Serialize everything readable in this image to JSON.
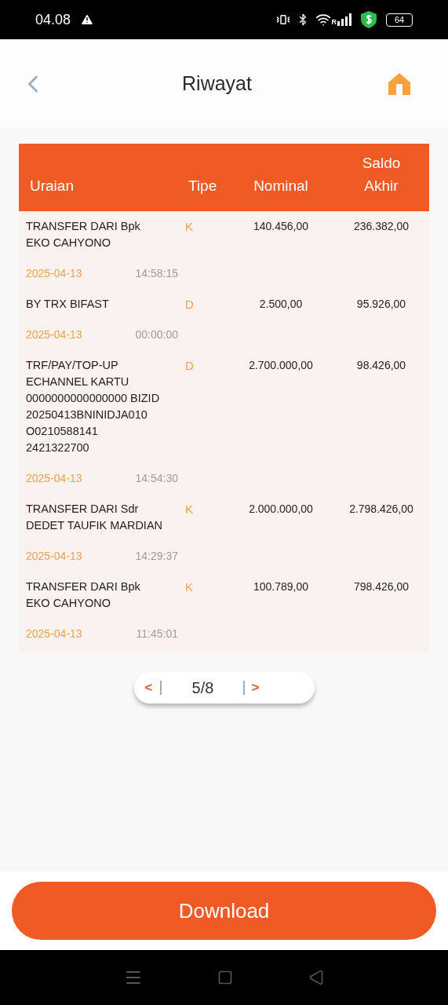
{
  "status_bar": {
    "time": "04.08",
    "network_label": "R",
    "battery": "64"
  },
  "header": {
    "title": "Riwayat"
  },
  "table": {
    "columns": [
      "Uraian",
      "Tipe",
      "Nominal",
      "Saldo Akhir"
    ],
    "rows": [
      {
        "description": "TRANSFER DARI Bpk EKO CAHYONO",
        "type": "K",
        "nominal": "140.456,00",
        "balance": "236.382,00",
        "date": "2025-04-13",
        "time": "14:58:15"
      },
      {
        "description": "BY TRX BIFAST",
        "type": "D",
        "nominal": "2.500,00",
        "balance": "95.926,00",
        "date": "2025-04-13",
        "time": "00:00:00"
      },
      {
        "description": "TRF/PAY/TOP-UP ECHANNEL KARTU 0000000000000000 BIZID 20250413BNINIDJA010 O0210588141 2421322700",
        "type": "D",
        "nominal": "2.700.000,00",
        "balance": "98.426,00",
        "date": "2025-04-13",
        "time": "14:54:30"
      },
      {
        "description": "TRANSFER DARI Sdr DEDET TAUFIK MARDIAN",
        "type": "K",
        "nominal": "2.000.000,00",
        "balance": "2.798.426,00",
        "date": "2025-04-13",
        "time": "14:29:37"
      },
      {
        "description": "TRANSFER DARI Bpk EKO CAHYONO",
        "type": "K",
        "nominal": "100.789,00",
        "balance": "798.426,00",
        "date": "2025-04-13",
        "time": "11:45:01"
      }
    ]
  },
  "pagination": {
    "prev": "<",
    "page": "5/8",
    "next": ">"
  },
  "download_button": "Download"
}
